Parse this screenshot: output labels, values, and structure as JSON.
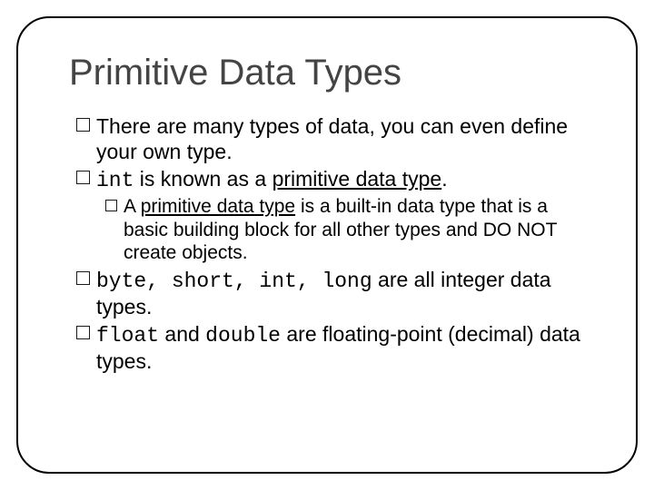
{
  "title": "Primitive Data Types",
  "bullets": {
    "b1a": "There are many types of data, you can even define your own type.",
    "b2_code": "int",
    "b2_rest_a": " is known as a ",
    "b2_ul": "primitive data type",
    "b2_rest_b": ".",
    "b2_1a": "A ",
    "b2_1ul": "primitive data type",
    "b2_1b": " is a built-in data type that is a basic building block for all other types and DO NOT create objects.",
    "b3_codes": "byte, short, int, long",
    "b3_rest": " are all integer data types.",
    "b4_code1": "float",
    "b4_mid": " and ",
    "b4_code2": "double",
    "b4_rest": " are floating-point (decimal) data types."
  }
}
